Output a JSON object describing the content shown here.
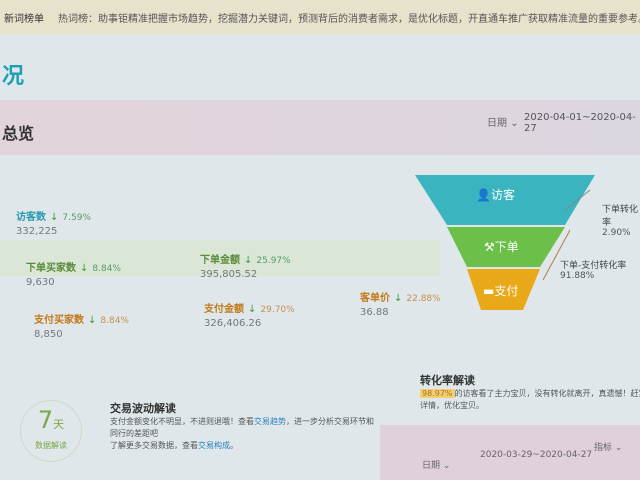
{
  "banner": {
    "label": "新词榜单",
    "text": "热词榜：助事钜精准把握市场趋势，挖掘潜力关键词，预测背后的消费者需求，是优化标题，开直通车推广获取精准流量的重要参考。"
  },
  "page_title": "况",
  "overview": {
    "title": "总览",
    "date_label": "日期",
    "date_range": "2020-04-01~2020-04-27"
  },
  "metrics": [
    {
      "label": "访客数",
      "pct": "7.59%",
      "value": "332,225"
    },
    {
      "label": "下单买家数",
      "pct": "8.84%",
      "value": "9,630"
    },
    {
      "label": "下单金额",
      "pct": "25.97%",
      "value": "395,805.52"
    },
    {
      "label": "支付买家数",
      "pct": "8.84%",
      "value": "8,850"
    },
    {
      "label": "支付金额",
      "pct": "29.70%",
      "value": "326,406.26"
    },
    {
      "label": "客单价",
      "pct": "22.88%",
      "value": "36.88"
    }
  ],
  "funnel": {
    "stages": [
      "访客",
      "下单",
      "支付"
    ],
    "colors": [
      "#3ab5c0",
      "#6cc04a",
      "#e8a818"
    ],
    "order_rate_label": "下单转化率",
    "order_rate": "2.90%",
    "pay_rate_label": "下单-支付转化率",
    "pay_rate": "91.88%"
  },
  "insight": {
    "badge_num": "7",
    "badge_unit": "天",
    "badge_text": "数据解读",
    "trade_title": "交易波动解读",
    "trade_l1a": "支付金额变化不明显，不进则退哦！查看",
    "trade_l1_link": "交易趋势",
    "trade_l1b": "，进一步分析交易环节和",
    "trade_l2": "同行的差距吧",
    "trade_l3a": "了解更多交易数据，查看",
    "trade_l3_link": "交易构成",
    "trade_l3b": "。",
    "conv_title": "转化率解读",
    "conv_pct": "98.97%",
    "conv_text": "的访客看了主力宝贝，没有转化就离开，真遗憾！赶紧完善宝贝",
    "conv_text2": "详情，优化宝贝。"
  },
  "bottom": {
    "date_label": "日期",
    "date_range": "2020-03-29~2020-04-27",
    "metric_label": "指标"
  }
}
